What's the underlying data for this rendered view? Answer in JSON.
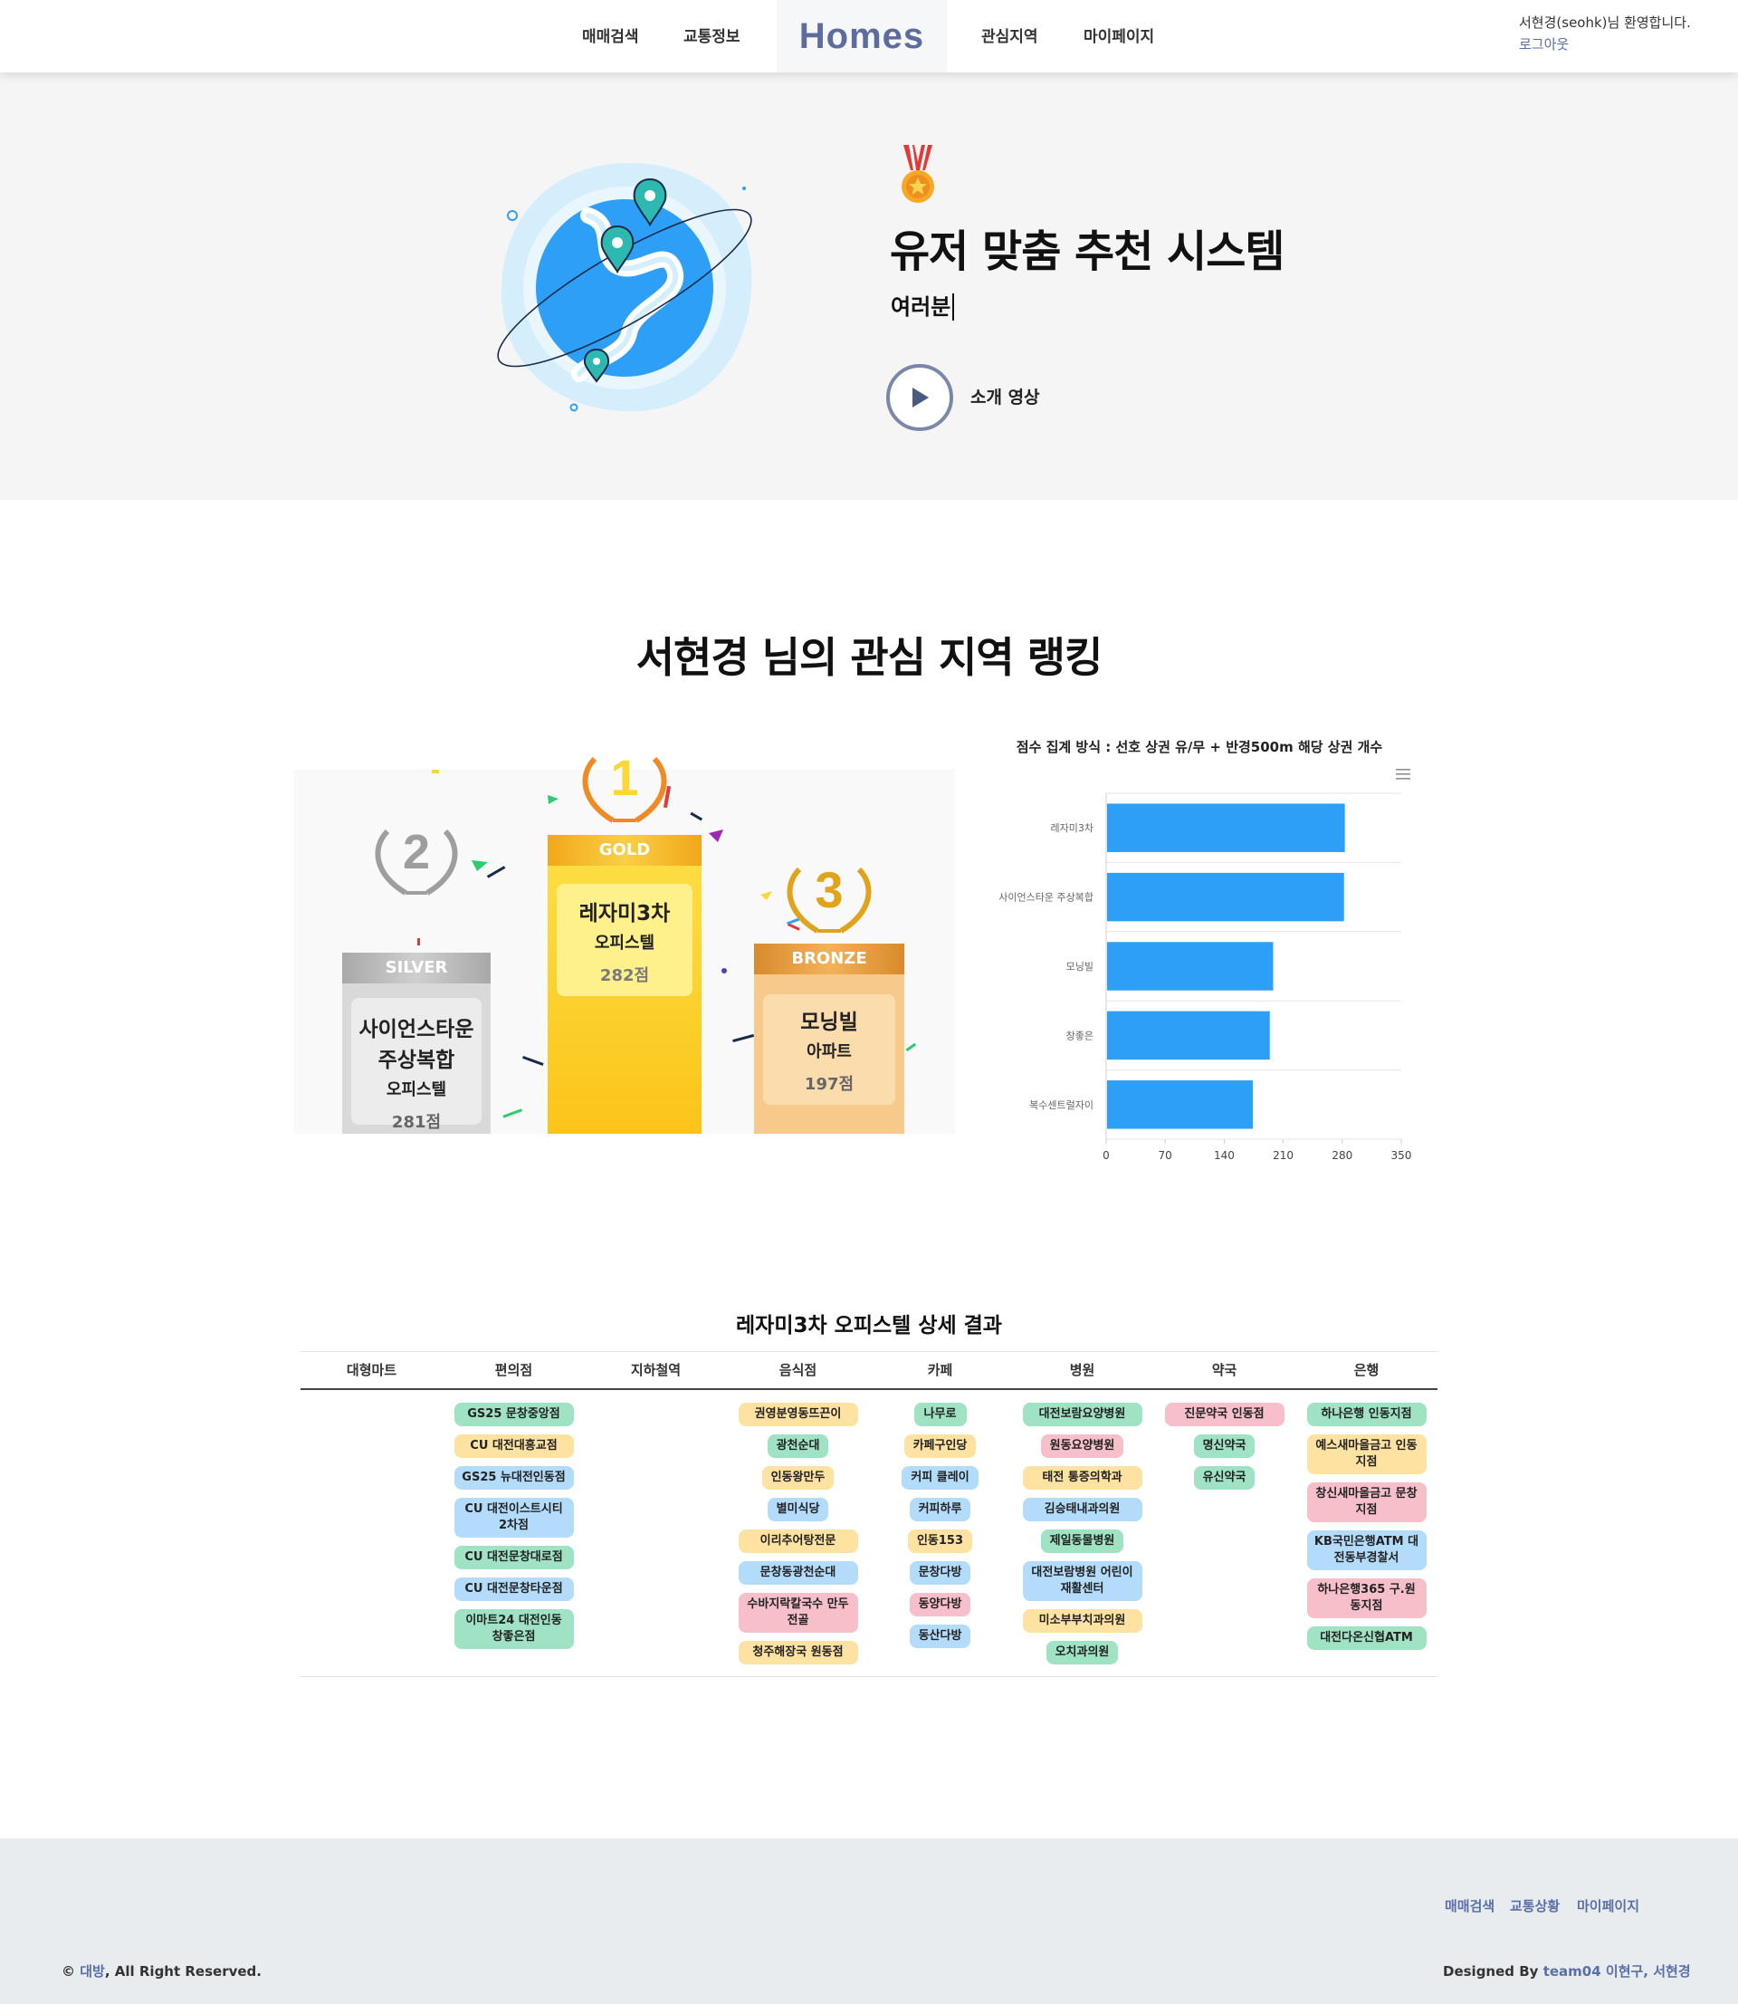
{
  "header": {
    "nav_left": [
      "매매검색",
      "교통정보"
    ],
    "logo": "Homes",
    "nav_right": [
      "관심지역",
      "마이페이지"
    ],
    "greeting": "서현경(seohk)님 환영합니다.",
    "logout": "로그아웃"
  },
  "hero": {
    "title": "유저 맞춤 추천 시스템",
    "typing_text": "여러분",
    "video_label": "소개 영상",
    "icons": [
      "globe-map-illustration",
      "medal-icon",
      "play-icon"
    ]
  },
  "ranking": {
    "title": "서현경 님의 관심 지역 랭킹",
    "podium": [
      {
        "rank": "2",
        "badge": "SILVER",
        "name_lines": [
          "사이언스타운",
          "주상복합"
        ],
        "type": "오피스텔",
        "score": "281점"
      },
      {
        "rank": "1",
        "badge": "GOLD",
        "name_lines": [
          "레자미3차"
        ],
        "type": "오피스텔",
        "score": "282점"
      },
      {
        "rank": "3",
        "badge": "BRONZE",
        "name_lines": [
          "모닝빌"
        ],
        "type": "아파트",
        "score": "197점"
      }
    ],
    "colors": {
      "gold": "#fdd835",
      "silver": "#d9d9d9",
      "bronze": "#f7c98a",
      "bar": "#2e9ff6"
    }
  },
  "chart_data": {
    "type": "bar",
    "orientation": "horizontal",
    "title": "점수 집계 방식 : 선호 상권 유/무 + 반경500m 해당 상권 개수",
    "categories": [
      "레자미3차",
      "사이언스타운 주상복합",
      "모닝빌",
      "창좋은",
      "복수센트럴자이"
    ],
    "values": [
      282,
      281,
      197,
      193,
      173
    ],
    "xlim": [
      0,
      350
    ],
    "xticks": [
      "0",
      "70",
      "140",
      "210",
      "280",
      "350"
    ],
    "grid": true,
    "color": "#2e9ff6"
  },
  "detail": {
    "title": "레자미3차 오피스텔 상세 결과",
    "columns": [
      {
        "header": "대형마트",
        "items": []
      },
      {
        "header": "편의점",
        "items": [
          {
            "label": "GS25 문창중앙점",
            "color": "green"
          },
          {
            "label": "CU 대전대흥교점",
            "color": "yellow"
          },
          {
            "label": "GS25 뉴대전인동점",
            "color": "blue"
          },
          {
            "label": "CU 대전이스트시티 2차점",
            "color": "blue"
          },
          {
            "label": "CU 대전문창대로점",
            "color": "green"
          },
          {
            "label": "CU 대전문창타운점",
            "color": "blue"
          },
          {
            "label": "이마트24 대전인동 창좋은점",
            "color": "green"
          }
        ]
      },
      {
        "header": "지하철역",
        "items": []
      },
      {
        "header": "음식점",
        "items": [
          {
            "label": "권영분영동뜨끈이",
            "color": "yellow"
          },
          {
            "label": "광천순대",
            "color": "green"
          },
          {
            "label": "인동왕만두",
            "color": "yellow"
          },
          {
            "label": "별미식당",
            "color": "blue"
          },
          {
            "label": "이리추어탕전문",
            "color": "yellow"
          },
          {
            "label": "문창동광천순대",
            "color": "blue"
          },
          {
            "label": "수바지락칼국수 만두전골",
            "color": "pink"
          },
          {
            "label": "청주해장국 원동점",
            "color": "yellow"
          }
        ]
      },
      {
        "header": "카페",
        "items": [
          {
            "label": "나무로",
            "color": "green"
          },
          {
            "label": "카페구인당",
            "color": "yellow"
          },
          {
            "label": "커피 클레이",
            "color": "blue"
          },
          {
            "label": "커피하루",
            "color": "blue"
          },
          {
            "label": "인동153",
            "color": "yellow"
          },
          {
            "label": "문창다방",
            "color": "blue"
          },
          {
            "label": "동양다방",
            "color": "pink"
          },
          {
            "label": "동산다방",
            "color": "blue"
          }
        ]
      },
      {
        "header": "병원",
        "items": [
          {
            "label": "대전보람요양병원",
            "color": "green"
          },
          {
            "label": "원동요양병원",
            "color": "pink"
          },
          {
            "label": "태전 통증의학과",
            "color": "yellow"
          },
          {
            "label": "김승태내과의원",
            "color": "blue"
          },
          {
            "label": "제일동물병원",
            "color": "green"
          },
          {
            "label": "대전보람병원 어린이 재활센터",
            "color": "blue"
          },
          {
            "label": "미소부부치과의원",
            "color": "yellow"
          },
          {
            "label": "오치과의원",
            "color": "green"
          }
        ]
      },
      {
        "header": "약국",
        "items": [
          {
            "label": "진문약국 인동점",
            "color": "pink"
          },
          {
            "label": "명신약국",
            "color": "green"
          },
          {
            "label": "유신약국",
            "color": "green"
          }
        ]
      },
      {
        "header": "은행",
        "items": [
          {
            "label": "하나은행 인동지점",
            "color": "green"
          },
          {
            "label": "예스새마을금고 인동 지점",
            "color": "yellow"
          },
          {
            "label": "창신새마을금고 문창 지점",
            "color": "pink"
          },
          {
            "label": "KB국민은행ATM 대전동부경찰서",
            "color": "blue"
          },
          {
            "label": "하나은행365 구.원 동지점",
            "color": "pink"
          },
          {
            "label": "대전다온신협ATM",
            "color": "green"
          }
        ]
      }
    ],
    "tag_colors": {
      "green": "#9fe3c4",
      "yellow": "#fde2a1",
      "blue": "#b3dcfb",
      "pink": "#f6bfca"
    }
  },
  "footer": {
    "links": [
      "매매검색",
      "교통상황",
      "마이페이지"
    ],
    "copyright_prefix": "©",
    "copyright_brand": "대방",
    "copyright_suffix": ", All Right Reserved.",
    "designed_prefix": "Designed By",
    "designed_team": "team04 이현구, 서현경"
  }
}
